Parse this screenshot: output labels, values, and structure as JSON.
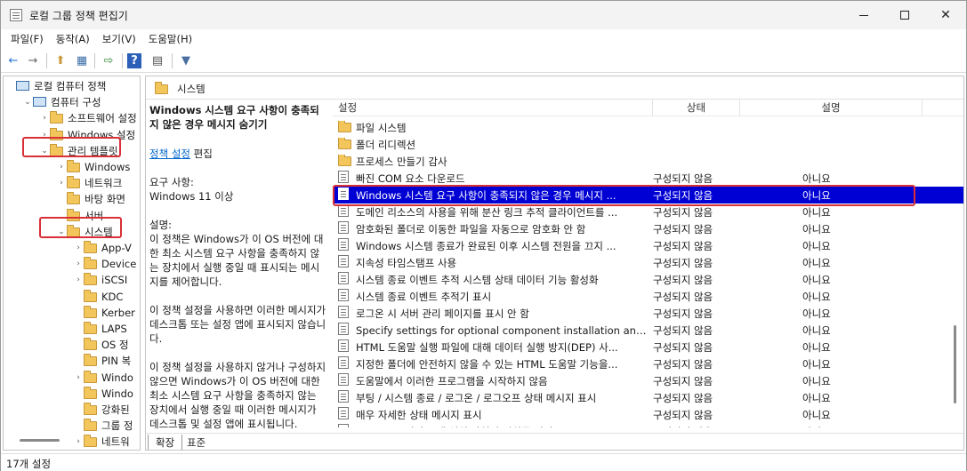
{
  "window": {
    "title": "로컬 그룹 정책 편집기"
  },
  "menu": [
    "파일(F)",
    "동작(A)",
    "보기(V)",
    "도움말(H)"
  ],
  "toolbar": {
    "back": "←",
    "forward": "→",
    "up": "⬆",
    "show_hide": "▦",
    "export": "⇨",
    "help": "?",
    "view": "▤",
    "filter": "▼"
  },
  "tree": [
    {
      "label": "로컬 컴퓨터 정책",
      "indent": 0,
      "exp": "",
      "icon": "pc"
    },
    {
      "label": "컴퓨터 구성",
      "indent": 1,
      "exp": "⌄",
      "icon": "pc"
    },
    {
      "label": "소프트웨어 설정",
      "indent": 2,
      "exp": "›",
      "icon": "folder"
    },
    {
      "label": "Windows 설정",
      "indent": 2,
      "exp": "›",
      "icon": "folder"
    },
    {
      "label": "관리 템플릿",
      "indent": 2,
      "exp": "⌄",
      "icon": "folder"
    },
    {
      "label": "Windows",
      "indent": 3,
      "exp": "›",
      "icon": "folder"
    },
    {
      "label": "네트워크",
      "indent": 3,
      "exp": "›",
      "icon": "folder"
    },
    {
      "label": "바탕 화면",
      "indent": 3,
      "exp": "",
      "icon": "folder"
    },
    {
      "label": "서버",
      "indent": 3,
      "exp": "",
      "icon": "folder"
    },
    {
      "label": "시스템",
      "indent": 3,
      "exp": "⌄",
      "icon": "folder"
    },
    {
      "label": "App-V",
      "indent": 4,
      "exp": "›",
      "icon": "folder"
    },
    {
      "label": "Device",
      "indent": 4,
      "exp": "›",
      "icon": "folder"
    },
    {
      "label": "iSCSI",
      "indent": 4,
      "exp": "›",
      "icon": "folder"
    },
    {
      "label": "KDC",
      "indent": 4,
      "exp": "",
      "icon": "folder"
    },
    {
      "label": "Kerber",
      "indent": 4,
      "exp": "",
      "icon": "folder"
    },
    {
      "label": "LAPS",
      "indent": 4,
      "exp": "",
      "icon": "folder"
    },
    {
      "label": "OS 정",
      "indent": 4,
      "exp": "",
      "icon": "folder"
    },
    {
      "label": "PIN 복",
      "indent": 4,
      "exp": "",
      "icon": "folder"
    },
    {
      "label": "Windo",
      "indent": 4,
      "exp": "›",
      "icon": "folder"
    },
    {
      "label": "Windo",
      "indent": 4,
      "exp": "",
      "icon": "folder"
    },
    {
      "label": "강화된",
      "indent": 4,
      "exp": "",
      "icon": "folder"
    },
    {
      "label": "그룹 정",
      "indent": 4,
      "exp": "",
      "icon": "folder"
    },
    {
      "label": "네트워",
      "indent": 4,
      "exp": "›",
      "icon": "folder"
    }
  ],
  "right_header": {
    "title": "시스템"
  },
  "description": {
    "title": "Windows 시스템 요구 사항이 충족되지 않은 경우 메시지 숨기기",
    "link": "정책 설정",
    "edit": " 편집",
    "req_label": "요구 사항:",
    "req_value": "Windows 11 이상",
    "desc_label": "설명:",
    "p1": "이 정책은 Windows가 이 OS 버전에 대한 최소 시스템 요구 사항을 충족하지 않는 장치에서 실행 중일 때 표시되는 메시지를 제어합니다.",
    "p2": "이 정책 설정을 사용하면 이러한 메시지가 데스크톱 또는 설정 앱에 표시되지 않습니다.",
    "p3": "이 정책 설정을 사용하지 않거나 구성하지 않으면 Windows가 이 OS 버전에 대한 최소 시스템 요구 사항을 충족하지 않는 장치에서 실행 중일 때 이러한 메시지가 데스크톱 및 설정 앱에 표시됩니다."
  },
  "columns": {
    "name": "설정",
    "state": "상태",
    "comment": "설명"
  },
  "rows": [
    {
      "name": "파일 시스템",
      "state": "",
      "comment": "",
      "icon": "folder"
    },
    {
      "name": "폴더 리디렉션",
      "state": "",
      "comment": "",
      "icon": "folder"
    },
    {
      "name": "프로세스 만들기 감사",
      "state": "",
      "comment": "",
      "icon": "folder"
    },
    {
      "name": "빠진 COM 요소 다운로드",
      "state": "구성되지 않음",
      "comment": "아니요",
      "icon": "policy"
    },
    {
      "name": "Windows 시스템 요구 사항이 충족되지 않은 경우 메시지 ...",
      "state": "구성되지 않음",
      "comment": "아니요",
      "icon": "policy",
      "selected": true
    },
    {
      "name": "도메인 리소스의 사용을 위해 분산 링크 추적 클라이언트를 ...",
      "state": "구성되지 않음",
      "comment": "아니요",
      "icon": "policy"
    },
    {
      "name": "암호화된 폴더로 이동한 파일을 자동으로 암호화 안 함",
      "state": "구성되지 않음",
      "comment": "아니요",
      "icon": "policy"
    },
    {
      "name": "Windows 시스템 종료가 완료된 이후 시스템 전원을 끄지 ...",
      "state": "구성되지 않음",
      "comment": "아니요",
      "icon": "policy"
    },
    {
      "name": "지속성 타임스탬프 사용",
      "state": "구성되지 않음",
      "comment": "아니요",
      "icon": "policy"
    },
    {
      "name": "시스템 종료 이벤트 추적 시스템 상태 데이터 기능 활성화",
      "state": "구성되지 않음",
      "comment": "아니요",
      "icon": "policy"
    },
    {
      "name": "시스템 종료 이벤트 추적기 표시",
      "state": "구성되지 않음",
      "comment": "아니요",
      "icon": "policy"
    },
    {
      "name": "로그온 시 서버 관리 페이지를 표시 안 함",
      "state": "구성되지 않음",
      "comment": "아니요",
      "icon": "policy"
    },
    {
      "name": "Specify settings for optional component installation and c...",
      "state": "구성되지 않음",
      "comment": "아니요",
      "icon": "policy"
    },
    {
      "name": "HTML 도움말 실행 파일에 대해 데이터 실행 방지(DEP) 사...",
      "state": "구성되지 않음",
      "comment": "아니요",
      "icon": "policy"
    },
    {
      "name": "지정한 폴더에 안전하지 않을 수 있는 HTML 도움말 기능을...",
      "state": "구성되지 않음",
      "comment": "아니요",
      "icon": "policy"
    },
    {
      "name": "도움말에서 이러한 프로그램을 시작하지 않음",
      "state": "구성되지 않음",
      "comment": "아니요",
      "icon": "policy"
    },
    {
      "name": "부팅 / 시스템 종료 / 로그온 / 로그오프 상태 메시지 표시",
      "state": "구성되지 않음",
      "comment": "아니요",
      "icon": "policy"
    },
    {
      "name": "매우 자세한 상태 메시지 표시",
      "state": "구성되지 않음",
      "comment": "아니요",
      "icon": "policy"
    },
    {
      "name": "Windows 서비스 팩 설치 파일의 위치를 지정",
      "state": "구성되지 않음",
      "comment": "아니요",
      "icon": "policy"
    }
  ],
  "tabs": {
    "extended": "확장",
    "standard": "표준"
  },
  "status": {
    "text": "17개 설정"
  },
  "colors": {
    "selection": "#0000d4",
    "highlight": "#d93038",
    "link": "#0066cc"
  }
}
